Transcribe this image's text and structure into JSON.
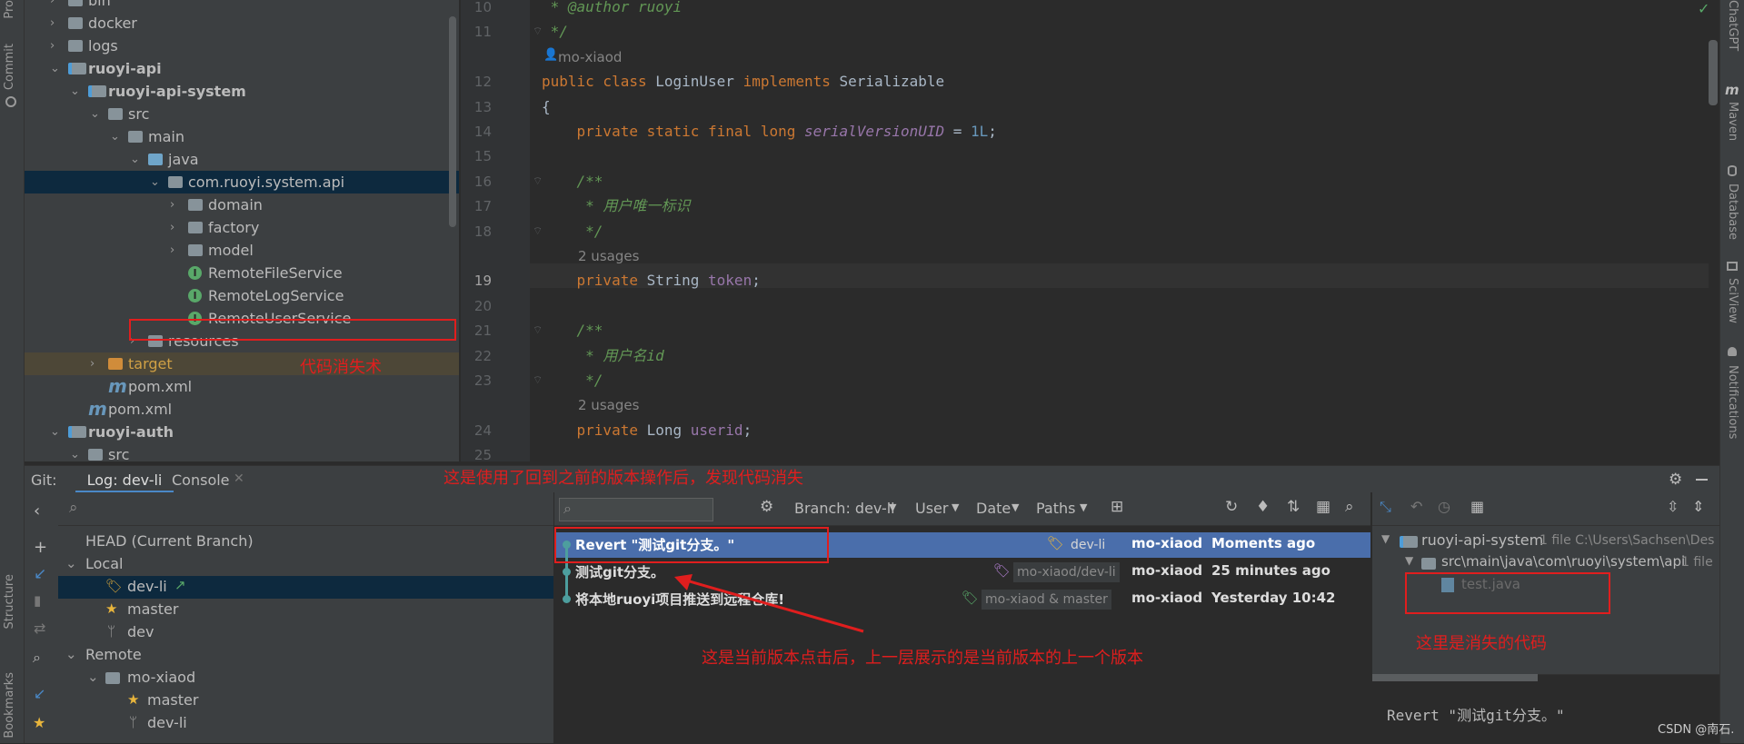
{
  "left_stripe": {
    "commit_label": "Commit",
    "structure_label": "Structure",
    "bookmarks_label": "Bookmarks",
    "project_label": "Pro"
  },
  "right_stripe": {
    "chatgpt_label": "ChatGPT",
    "maven_label": "Maven",
    "database_label": "Database",
    "sciview_label": "SciView",
    "notifications_label": "Notifications"
  },
  "project_tree": [
    {
      "label": "bin",
      "indent": 0,
      "type": "folder",
      "arrow": ">"
    },
    {
      "label": "docker",
      "indent": 0,
      "type": "folder",
      "arrow": ">"
    },
    {
      "label": "logs",
      "indent": 0,
      "type": "folder",
      "arrow": ">"
    },
    {
      "label": "ruoyi-api",
      "indent": 0,
      "type": "module",
      "arrow": "v",
      "bold": true
    },
    {
      "label": "ruoyi-api-system",
      "indent": 1,
      "type": "module",
      "arrow": "v",
      "bold": true
    },
    {
      "label": "src",
      "indent": 2,
      "type": "folder",
      "arrow": "v"
    },
    {
      "label": "main",
      "indent": 3,
      "type": "folder",
      "arrow": "v"
    },
    {
      "label": "java",
      "indent": 4,
      "type": "folder-blue",
      "arrow": "v"
    },
    {
      "label": "com.ruoyi.system.api",
      "indent": 5,
      "type": "package",
      "arrow": "v",
      "selected": true
    },
    {
      "label": "domain",
      "indent": 6,
      "type": "package",
      "arrow": ">"
    },
    {
      "label": "factory",
      "indent": 6,
      "type": "package",
      "arrow": ">"
    },
    {
      "label": "model",
      "indent": 6,
      "type": "package",
      "arrow": ">"
    },
    {
      "label": "RemoteFileService",
      "indent": 6,
      "type": "interface",
      "arrow": ""
    },
    {
      "label": "RemoteLogService",
      "indent": 6,
      "type": "interface",
      "arrow": ""
    },
    {
      "label": "RemoteUserService",
      "indent": 6,
      "type": "interface",
      "arrow": ""
    },
    {
      "label": "resources",
      "indent": 4,
      "type": "folder",
      "arrow": ">"
    },
    {
      "label": "target",
      "indent": 2,
      "type": "folder-orange",
      "arrow": ">",
      "highlight": true
    },
    {
      "label": "pom.xml",
      "indent": 2,
      "type": "maven",
      "arrow": ""
    },
    {
      "label": "pom.xml",
      "indent": 1,
      "type": "maven",
      "arrow": ""
    },
    {
      "label": "ruoyi-auth",
      "indent": 0,
      "type": "module",
      "arrow": "v",
      "bold": true
    },
    {
      "label": "src",
      "indent": 1,
      "type": "folder",
      "arrow": "v"
    }
  ],
  "editor": {
    "lines": [
      {
        "n": "10",
        "html": "<span class='cmt'> * @author ruoyi</span>"
      },
      {
        "n": "11",
        "html": "<span class='cmt'> */</span>"
      },
      {
        "n": "",
        "hint": "mo-xiaod"
      },
      {
        "n": "12",
        "html": "<span class='kw'>public class</span> LoginUser <span class='kw'>implements</span> Serializable"
      },
      {
        "n": "13",
        "html": "{"
      },
      {
        "n": "14",
        "html": "    <span class='kw'>private static final long</span> <span class='fld ital'>serialVersionUID</span> = <span class='num'>1L</span>;"
      },
      {
        "n": "15",
        "html": ""
      },
      {
        "n": "16",
        "html": "    <span class='cmt'>/**</span>"
      },
      {
        "n": "17",
        "html": "    <span class='cmt'> * 用户唯一标识</span>"
      },
      {
        "n": "18",
        "html": "    <span class='cmt'> */</span>"
      },
      {
        "n": "",
        "hint": "2 usages"
      },
      {
        "n": "19",
        "html": "    <span class='kw'>private</span> String <span class='fld'>token</span>;",
        "current": true
      },
      {
        "n": "20",
        "html": ""
      },
      {
        "n": "21",
        "html": "    <span class='cmt'>/**</span>"
      },
      {
        "n": "22",
        "html": "    <span class='cmt'> * 用户名id</span>"
      },
      {
        "n": "23",
        "html": "    <span class='cmt'> */</span>"
      },
      {
        "n": "",
        "hint": "2 usages"
      },
      {
        "n": "24",
        "html": "    <span class='kw'>private</span> Long <span class='fld'>userid</span>;"
      },
      {
        "n": "25",
        "html": ""
      }
    ]
  },
  "git": {
    "prefix": "Git:",
    "tab_log": "Log: dev-li",
    "tab_console": "Console",
    "branches": {
      "head": "HEAD (Current Branch)",
      "local_label": "Local",
      "local": [
        "dev-li",
        "master",
        "dev"
      ],
      "remote_label": "Remote",
      "remote_group": "mo-xiaod",
      "remote": [
        "master",
        "dev-li"
      ]
    },
    "toolbar": {
      "branch": "Branch: dev-li",
      "user": "User",
      "date": "Date",
      "paths": "Paths"
    },
    "commits": [
      {
        "message": "Revert \"测试git分支。\"",
        "tag": "dev-li",
        "author": "mo-xiaod",
        "time": "Moments ago",
        "selected": true
      },
      {
        "message": "测试git分支。",
        "tag": "mo-xiaod/dev-li",
        "author": "mo-xiaod",
        "time": "25 minutes ago"
      },
      {
        "message": "将本地ruoyi项目推送到远程仓库!",
        "tag": "mo-xiaod & master",
        "author": "mo-xiaod",
        "time": "Yesterday 10:42"
      }
    ],
    "details": {
      "module": "ruoyi-api-system",
      "module_meta": "1 file  C:\\Users\\Sachsen\\Des",
      "path": "src\\main\\java\\com\\ruoyi\\system\\api",
      "path_meta": "1 file",
      "file": "test.java",
      "commit_message": "Revert \"测试git分支。\""
    }
  },
  "annotations": {
    "code_lost": "代码消失术",
    "after_revert": "这是使用了回到之前的版本操作后，发现代码消失",
    "current_version": "这是当前版本点击后，上一层展示的是当前版本的上一个版本",
    "lost_code": "这里是消失的代码"
  },
  "watermark": "CSDN @南石."
}
